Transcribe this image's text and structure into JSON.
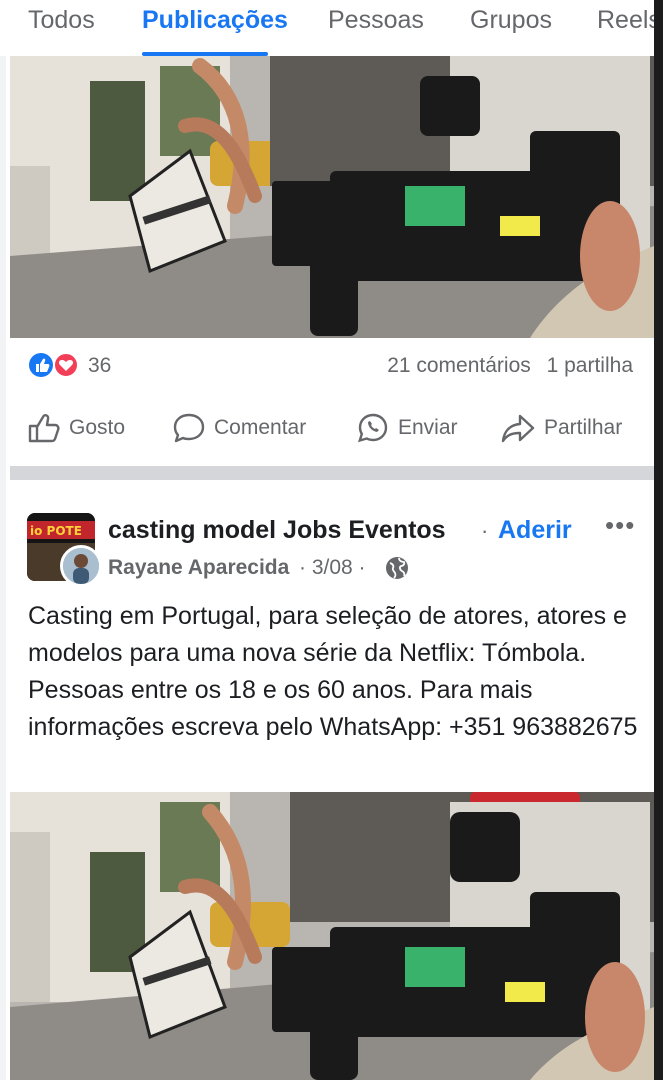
{
  "tabs": [
    "Todos",
    "Publicações",
    "Pessoas",
    "Grupos",
    "Reels"
  ],
  "active_tab": "Publicações",
  "post_top": {
    "reaction_count": "36",
    "comments": "21 comentários",
    "shares": "1 partilha",
    "reaction_icons": [
      "like-icon",
      "love-icon"
    ]
  },
  "actions": {
    "like": "Gosto",
    "comment": "Comentar",
    "send": "Enviar",
    "share": "Partilhar"
  },
  "post": {
    "group_name": "casting model Jobs  Eventos",
    "separator": "·",
    "join": "Aderir",
    "more": "•••",
    "author": "Rayane Aparecida",
    "date": "· 3/08 ·",
    "text": "Casting em Portugal, para seleção de atores, atores e modelos para uma nova série da Netflix: Tómbola. Pessoas entre os 18 e os 60 anos. Para mais informações escreva pelo WhatsApp: +351 963882675"
  },
  "colors": {
    "accent": "#1877f2",
    "secondary_text": "#65676b",
    "primary_text": "#1c1e21",
    "separator": "#d4d6da"
  }
}
